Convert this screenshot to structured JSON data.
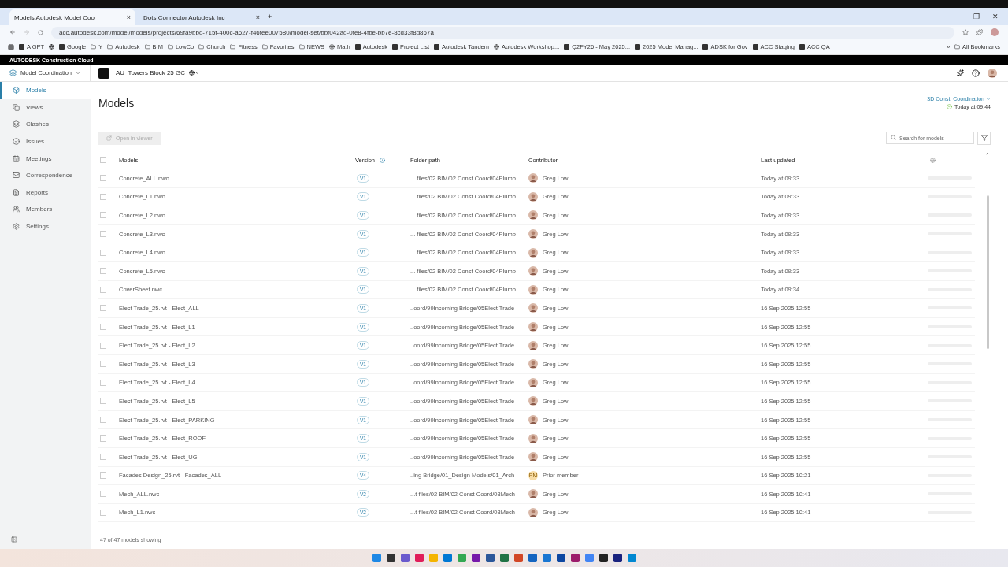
{
  "browser": {
    "tabs": [
      {
        "label": "Models  Autodesk Model Coo",
        "selected": true,
        "close": "×"
      },
      {
        "label": "Dots Connector  Autodesk Inc",
        "selected": false,
        "close": "×"
      }
    ],
    "new_tab": "+",
    "window_controls": [
      "–",
      "❐",
      "✕"
    ],
    "address": "acc.autodesk.com/model/models/projects/69fa9bbd-715f-400c-a627-f46fee007580/model-set/bbf042ad-0fe8-4fbe-bb7e-8cd33f8d867a",
    "bookmarks": [
      {
        "label": "A GPT",
        "kind": "site"
      },
      {
        "kind": "globe"
      },
      {
        "label": "Google",
        "kind": "site"
      },
      {
        "label": "Y",
        "kind": "folder"
      },
      {
        "label": "Autodesk",
        "kind": "folder"
      },
      {
        "label": "BIM",
        "kind": "folder"
      },
      {
        "label": "LowCo",
        "kind": "folder"
      },
      {
        "label": "Church",
        "kind": "folder"
      },
      {
        "label": "Fitness",
        "kind": "folder"
      },
      {
        "label": "Favorites",
        "kind": "folder"
      },
      {
        "label": "NEWS",
        "kind": "folder"
      },
      {
        "label": "Math",
        "kind": "globe"
      },
      {
        "label": "Autodesk",
        "kind": "site"
      },
      {
        "label": "Project List",
        "kind": "site"
      },
      {
        "label": "Autodesk Tandem",
        "kind": "site"
      },
      {
        "label": "Autodesk Workshop...",
        "kind": "globe"
      },
      {
        "label": "Q2FY26 - May 2025...",
        "kind": "site"
      },
      {
        "label": "2025 Model Manag...",
        "kind": "site"
      },
      {
        "label": "ADSK for Gov",
        "kind": "site"
      },
      {
        "label": "ACC Staging",
        "kind": "site"
      },
      {
        "label": "ACC QA",
        "kind": "site"
      }
    ],
    "more": "»",
    "all_bookmarks": "All Bookmarks"
  },
  "brand": "AUTODESK Construction Cloud",
  "header": {
    "module": "Model Coordination",
    "project": "AU_Towers Block 25 GC"
  },
  "sidebar": {
    "items": [
      {
        "label": "Models",
        "selected": true
      },
      {
        "label": "Views",
        "selected": false
      },
      {
        "label": "Clashes",
        "selected": false
      },
      {
        "label": "Issues",
        "selected": false
      },
      {
        "label": "Meetings",
        "selected": false
      },
      {
        "label": "Correspondence",
        "selected": false
      },
      {
        "label": "Reports",
        "selected": false
      },
      {
        "label": "Members",
        "selected": false
      },
      {
        "label": "Settings",
        "selected": false
      }
    ]
  },
  "page": {
    "title": "Models",
    "model_set": "3D Const. Coordination",
    "synced": "Today at 09:44",
    "open_button": {
      "label": "Open in viewer",
      "disabled": true
    },
    "search": {
      "placeholder": "Search for models"
    }
  },
  "table": {
    "columns": [
      "Models",
      "Version",
      "Folder path",
      "Contributor",
      "Last updated"
    ],
    "all_checked": false,
    "rows": [
      {
        "checked": false,
        "name": "Concrete_ALL.nwc",
        "version": "V1",
        "folder": "... files/02 BIM/02 Const Coord/04Plumb",
        "contributor": "Greg Low",
        "updated": "Today at 09:33"
      },
      {
        "checked": false,
        "name": "Concrete_L1.nwc",
        "version": "V1",
        "folder": "... files/02 BIM/02 Const Coord/04Plumb",
        "contributor": "Greg Low",
        "updated": "Today at 09:33"
      },
      {
        "checked": false,
        "name": "Concrete_L2.nwc",
        "version": "V1",
        "folder": "... files/02 BIM/02 Const Coord/04Plumb",
        "contributor": "Greg Low",
        "updated": "Today at 09:33"
      },
      {
        "checked": false,
        "name": "Concrete_L3.nwc",
        "version": "V1",
        "folder": "... files/02 BIM/02 Const Coord/04Plumb",
        "contributor": "Greg Low",
        "updated": "Today at 09:33"
      },
      {
        "checked": false,
        "name": "Concrete_L4.nwc",
        "version": "V1",
        "folder": "... files/02 BIM/02 Const Coord/04Plumb",
        "contributor": "Greg Low",
        "updated": "Today at 09:33"
      },
      {
        "checked": false,
        "name": "Concrete_L5.nwc",
        "version": "V1",
        "folder": "... files/02 BIM/02 Const Coord/04Plumb",
        "contributor": "Greg Low",
        "updated": "Today at 09:33"
      },
      {
        "checked": false,
        "name": "CoverSheet.nwc",
        "version": "V1",
        "folder": "... files/02 BIM/02 Const Coord/04Plumb",
        "contributor": "Greg Low",
        "updated": "Today at 09:34"
      },
      {
        "checked": false,
        "name": "Elect Trade_25.rvt - Elect_ALL",
        "version": "V1",
        "folder": "..oord/99Incoming Bridge/05Elect Trade",
        "contributor": "Greg Low",
        "updated": "16 Sep 2025 12:55"
      },
      {
        "checked": false,
        "name": "Elect Trade_25.rvt - Elect_L1",
        "version": "V1",
        "folder": "..oord/99Incoming Bridge/05Elect Trade",
        "contributor": "Greg Low",
        "updated": "16 Sep 2025 12:55"
      },
      {
        "checked": false,
        "name": "Elect Trade_25.rvt - Elect_L2",
        "version": "V1",
        "folder": "..oord/99Incoming Bridge/05Elect Trade",
        "contributor": "Greg Low",
        "updated": "16 Sep 2025 12:55"
      },
      {
        "checked": false,
        "name": "Elect Trade_25.rvt - Elect_L3",
        "version": "V1",
        "folder": "..oord/99Incoming Bridge/05Elect Trade",
        "contributor": "Greg Low",
        "updated": "16 Sep 2025 12:55"
      },
      {
        "checked": false,
        "name": "Elect Trade_25.rvt - Elect_L4",
        "version": "V1",
        "folder": "..oord/99Incoming Bridge/05Elect Trade",
        "contributor": "Greg Low",
        "updated": "16 Sep 2025 12:55"
      },
      {
        "checked": false,
        "name": "Elect Trade_25.rvt - Elect_L5",
        "version": "V1",
        "folder": "..oord/99Incoming Bridge/05Elect Trade",
        "contributor": "Greg Low",
        "updated": "16 Sep 2025 12:55"
      },
      {
        "checked": false,
        "name": "Elect Trade_25.rvt - Elect_PARKING",
        "version": "V1",
        "folder": "..oord/99Incoming Bridge/05Elect Trade",
        "contributor": "Greg Low",
        "updated": "16 Sep 2025 12:55"
      },
      {
        "checked": false,
        "name": "Elect Trade_25.rvt - Elect_ROOF",
        "version": "V1",
        "folder": "..oord/99Incoming Bridge/05Elect Trade",
        "contributor": "Greg Low",
        "updated": "16 Sep 2025 12:55"
      },
      {
        "checked": false,
        "name": "Elect Trade_25.rvt - Elect_UG",
        "version": "V1",
        "folder": "..oord/99Incoming Bridge/05Elect Trade",
        "contributor": "Greg Low",
        "updated": "16 Sep 2025 12:55"
      },
      {
        "checked": false,
        "name": "Facades Design_25.rvt - Facades_ALL",
        "version": "V4",
        "folder": "..ing Bridge/01_Design Models/01_Arch",
        "contributor": "Prior member",
        "initials": "PM",
        "updated": "16 Sep 2025 10:21"
      },
      {
        "checked": false,
        "name": "Mech_ALL.nwc",
        "version": "V2",
        "folder": "...t files/02 BIM/02 Const Coord/03Mech",
        "contributor": "Greg Low",
        "updated": "16 Sep 2025 10:41"
      },
      {
        "checked": false,
        "name": "Mech_L1.nwc",
        "version": "V2",
        "folder": "...t files/02 BIM/02 Const Coord/03Mech",
        "contributor": "Greg Low",
        "updated": "16 Sep 2025 10:41"
      }
    ]
  },
  "footer": "47 of 47 models showing",
  "taskbar": [
    {
      "color": "#1e88e5"
    },
    {
      "color": "#333333"
    },
    {
      "color": "#6a5acd"
    },
    {
      "color": "#e01e5a"
    },
    {
      "color": "#f4b400"
    },
    {
      "color": "#0078d4"
    },
    {
      "color": "#34a853"
    },
    {
      "color": "#7719aa"
    },
    {
      "color": "#2b579a"
    },
    {
      "color": "#217346"
    },
    {
      "color": "#d24726"
    },
    {
      "color": "#1565c0"
    },
    {
      "color": "#1976d2"
    },
    {
      "color": "#0d47a1"
    },
    {
      "color": "#9c1c6b"
    },
    {
      "color": "#4285f4"
    },
    {
      "color": "#222222"
    },
    {
      "color": "#1a237e"
    },
    {
      "color": "#0288d1"
    }
  ]
}
